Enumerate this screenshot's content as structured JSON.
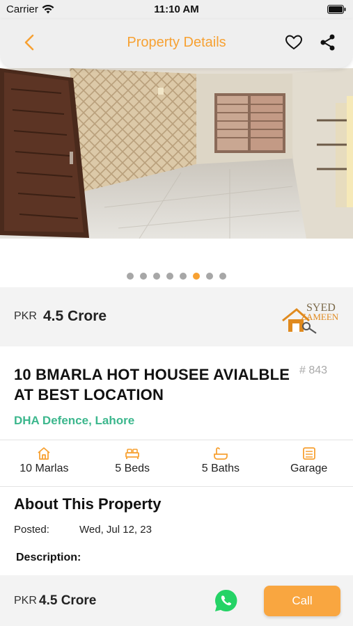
{
  "status_bar": {
    "carrier": "Carrier",
    "time": "11:10 AM"
  },
  "nav": {
    "title": "Property Details",
    "back_icon": "chevron-left-icon",
    "favorite_icon": "heart-icon",
    "share_icon": "share-icon"
  },
  "gallery": {
    "image_count": 8,
    "active_index": 5
  },
  "price": {
    "currency": "PKR",
    "amount": "4.5 Crore"
  },
  "agency_logo": {
    "line1": "SYED",
    "line2": "ZAMEEN"
  },
  "property": {
    "title": "10 BMARLA HOT  HOUSEE AVIALBLE AT BEST LOCATION",
    "id": "# 843",
    "location": "DHA Defence, Lahore"
  },
  "features": [
    {
      "icon": "home-icon",
      "label": "10 Marlas"
    },
    {
      "icon": "bed-icon",
      "label": "5 Beds"
    },
    {
      "icon": "bath-icon",
      "label": "5 Baths"
    },
    {
      "icon": "garage-icon",
      "label": "Garage"
    }
  ],
  "about": {
    "heading": "About This Property",
    "posted_label": "Posted:",
    "posted_value": "Wed, Jul 12, 23",
    "description_label": "Description:"
  },
  "bottom_bar": {
    "currency": "PKR",
    "amount": "4.5 Crore",
    "call_label": "Call"
  },
  "colors": {
    "accent": "#f7a132",
    "location": "#3cb78d",
    "whatsapp": "#25d366"
  }
}
